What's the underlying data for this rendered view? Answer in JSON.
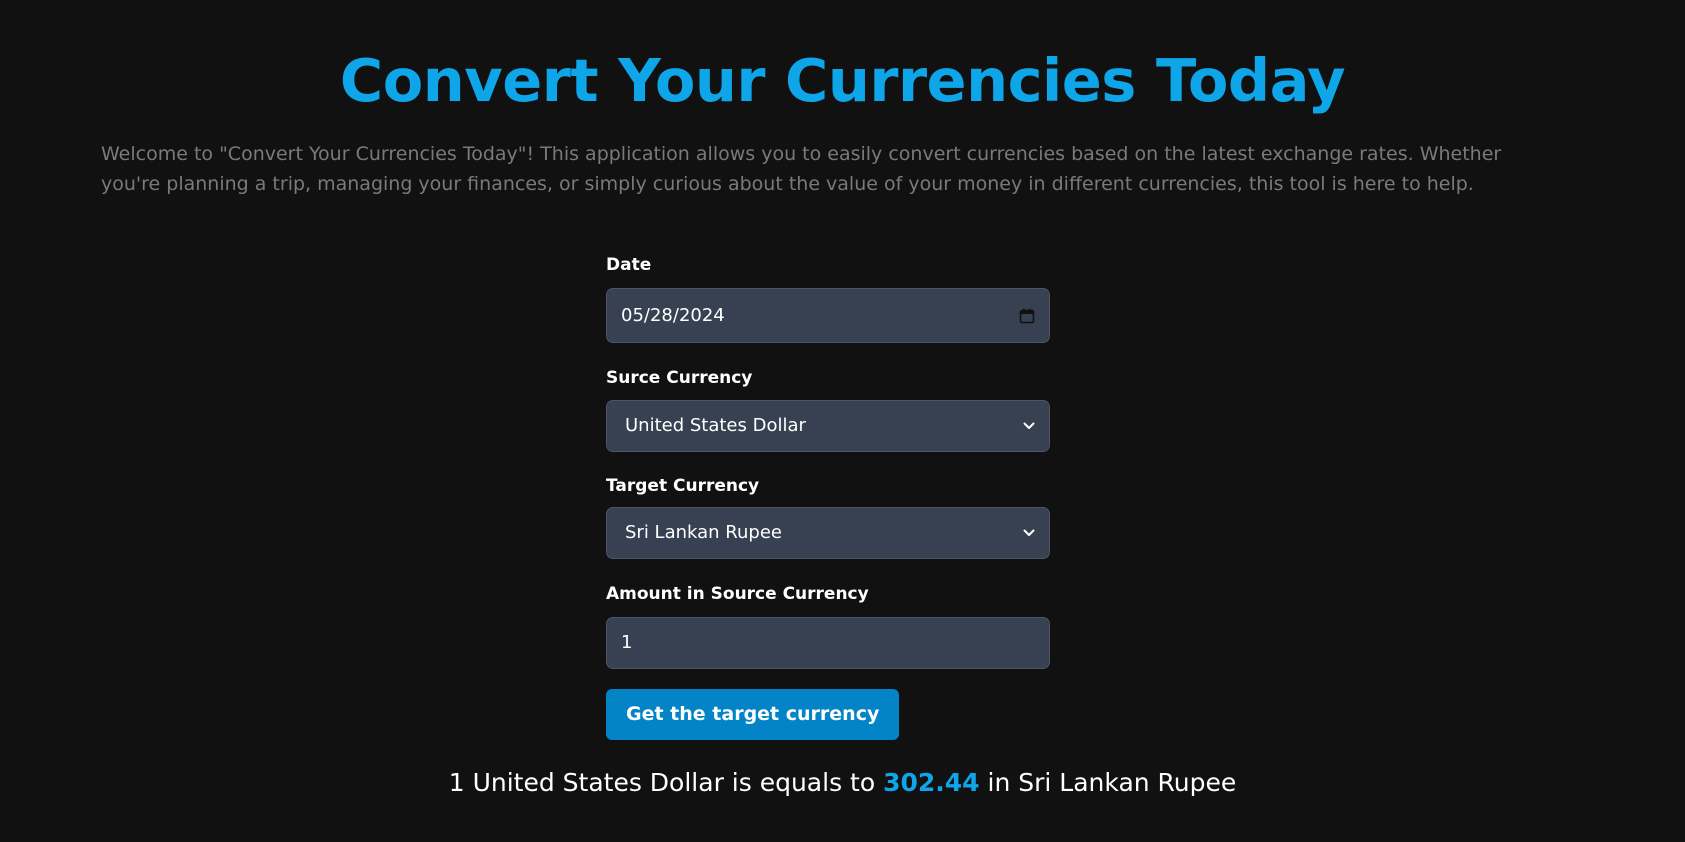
{
  "header": {
    "title": "Convert Your Currencies Today",
    "intro": "Welcome to \"Convert Your Currencies Today\"! This application allows you to easily convert currencies based on the latest exchange rates. Whether you're planning a trip, managing your finances, or simply curious about the value of your money in different currencies, this tool is here to help."
  },
  "form": {
    "date_label": "Date",
    "date_value": "05/28/2024",
    "source_label": "Surce Currency",
    "source_value": "United States Dollar",
    "target_label": "Target Currency",
    "target_value": "Sri Lankan Rupee",
    "amount_label": "Amount in Source Currency",
    "amount_value": "1",
    "submit_label": "Get the target currency"
  },
  "result": {
    "prefix": "1 United States Dollar is equals to",
    "value": "302.44",
    "suffix": "in Sri Lankan Rupee"
  },
  "icons": {
    "date_picker": "calendar-icon",
    "select": "chevron-down-icon"
  },
  "colors": {
    "background": "#111111",
    "accent": "#0ea5e9",
    "button": "#0284c7",
    "input_bg": "#374151",
    "muted_text": "#7a7a7a"
  }
}
